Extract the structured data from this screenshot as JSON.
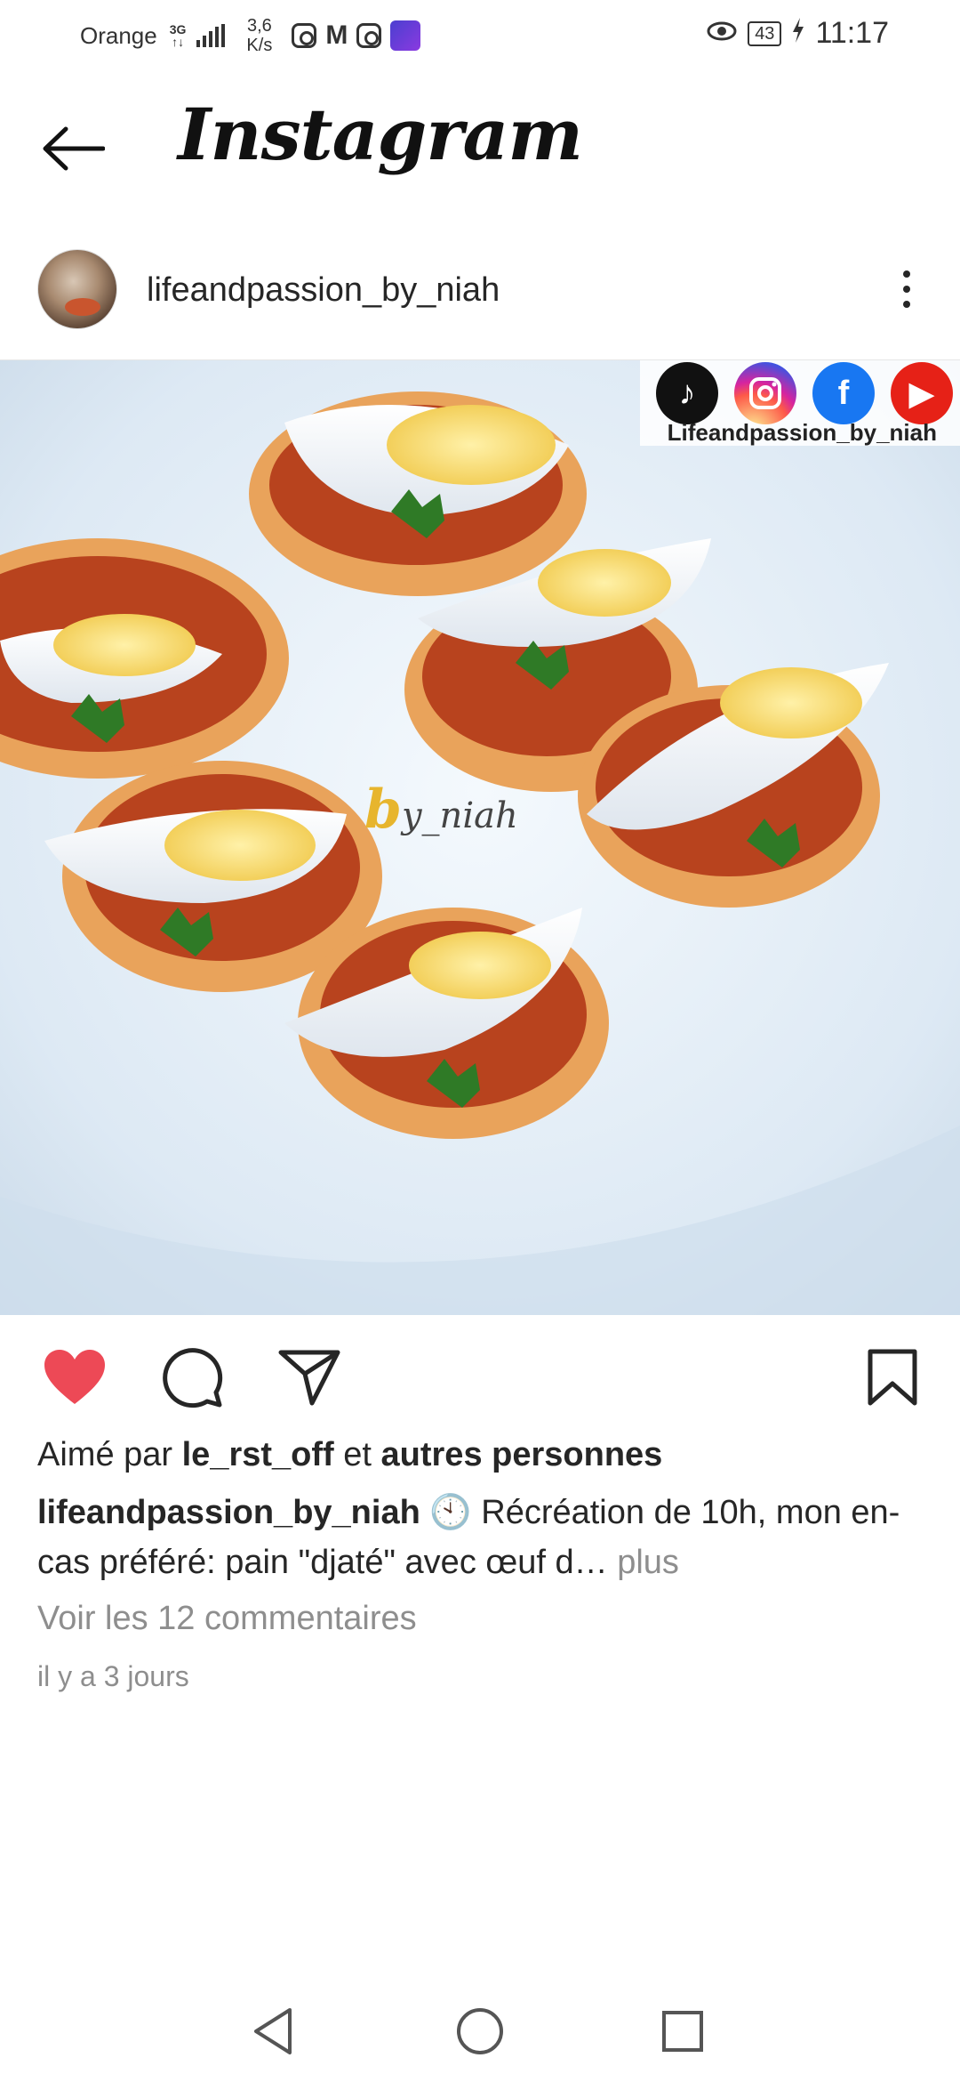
{
  "status_bar": {
    "carrier": "Orange",
    "network_top": "3G",
    "network_bottom": "↑↓",
    "speed_value": "3,6",
    "speed_unit": "K/s",
    "mail_icon": "M",
    "battery": "43",
    "time": "11:17"
  },
  "header": {
    "title": "Instagram"
  },
  "post": {
    "username": "lifeandpassion_by_niah",
    "image": {
      "social_handle": "Lifeandpassion_by_niah",
      "watermark_b": "b",
      "watermark_rest": "y_niah",
      "tiktok_glyph": "♪",
      "facebook_glyph": "f",
      "youtube_glyph": "▶"
    },
    "likes": {
      "prefix": "Aimé par",
      "user": "le_rst_off",
      "middle": "et",
      "others": "autres personnes"
    },
    "caption": {
      "author": "lifeandpassion_by_niah",
      "emoji": "🕙",
      "text": "Récréation de 10h, mon en-cas préféré: pain \"djaté\" avec œuf d…",
      "more": "plus"
    },
    "comments_link": "Voir les 12 commentaires",
    "timestamp": "il y a 3 jours"
  },
  "colors": {
    "like_red": "#ed4956",
    "text": "#262626",
    "muted": "#8e8e8e"
  },
  "icons": [
    "back-arrow-icon",
    "more-vertical-icon",
    "heart-icon",
    "comment-icon",
    "share-icon",
    "bookmark-icon",
    "nav-back-icon",
    "nav-home-icon",
    "nav-recent-icon"
  ]
}
